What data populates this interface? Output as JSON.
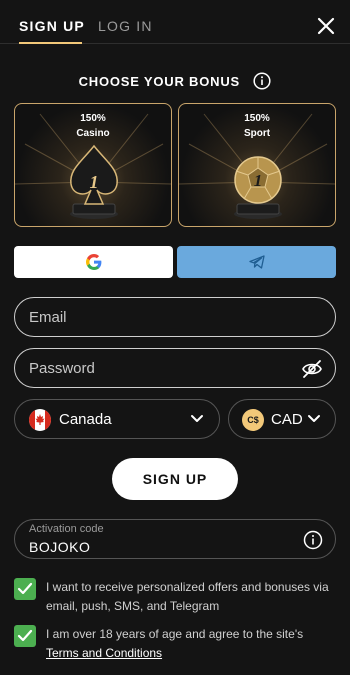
{
  "tabs": [
    {
      "label": "SIGN UP",
      "active": true
    },
    {
      "label": "LOG IN",
      "active": false
    }
  ],
  "bonus": {
    "heading": "CHOOSE YOUR BONUS",
    "cards": [
      {
        "percent": "150%",
        "name": "Casino",
        "rank": "1",
        "icon": "spade-trophy"
      },
      {
        "percent": "150%",
        "name": "Sport",
        "rank": "1",
        "icon": "soccer-ball-trophy"
      }
    ]
  },
  "social": {
    "google_icon": "google-icon",
    "telegram_icon": "telegram-icon"
  },
  "form": {
    "email_placeholder": "Email",
    "password_placeholder": "Password",
    "country": "Canada",
    "currency_symbol": "C$",
    "currency": "CAD",
    "signup_button": "SIGN UP",
    "activation_label": "Activation code",
    "activation_value": "BOJOKO"
  },
  "consents": {
    "offers_text": "I want to receive personalized offers and bonuses via email, push, SMS, and Telegram",
    "age_text": "I am over 18 years of age and agree to the site's ",
    "terms_link": "Terms and Conditions"
  },
  "colors": {
    "accent": "#f2c879",
    "check": "#4caf50",
    "telegram": "#6aa9dd",
    "background": "#141414"
  }
}
